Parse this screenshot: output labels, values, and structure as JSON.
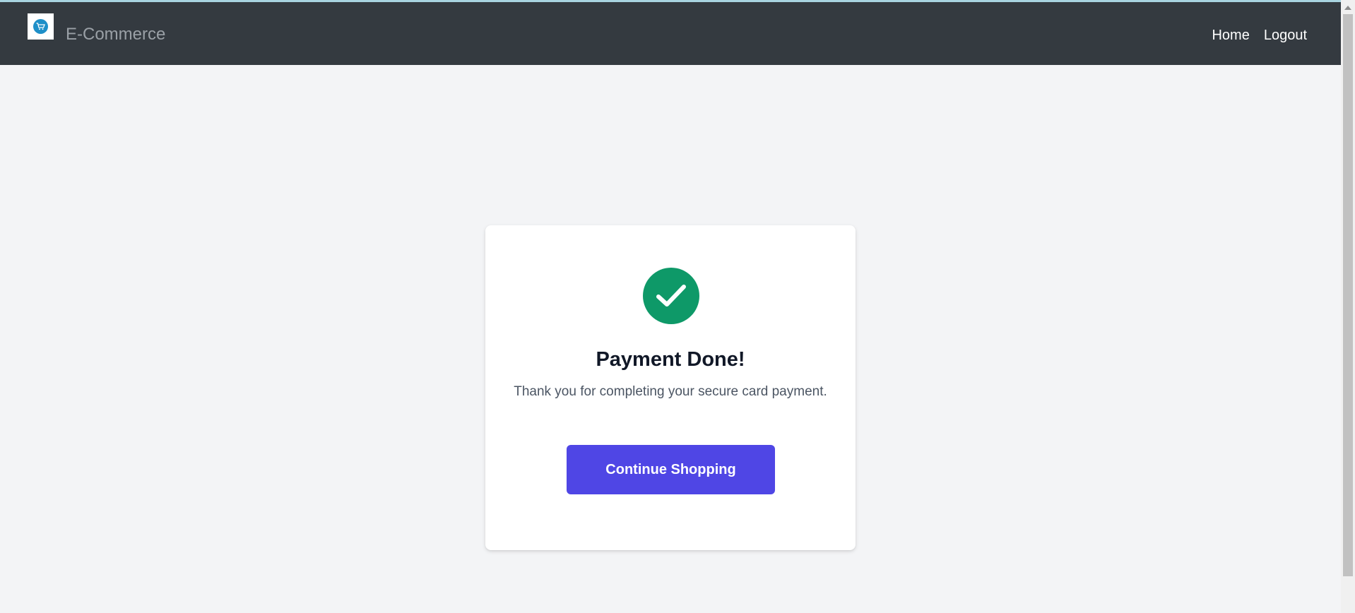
{
  "navbar": {
    "brand_logo_icon": "shopping-cart-icon",
    "brand_name": "E-Commerce",
    "links": [
      {
        "label": "Home"
      },
      {
        "label": "Logout"
      }
    ]
  },
  "confirmation": {
    "icon": "checkmark-icon",
    "title": "Payment Done!",
    "message": "Thank you for completing your secure card payment.",
    "button_label": "Continue Shopping"
  },
  "colors": {
    "navbar_bg": "#343a40",
    "page_bg": "#f3f4f6",
    "success_green": "#0e9968",
    "button_primary": "#4f46e5",
    "logo_blue": "#1e8fc8"
  }
}
